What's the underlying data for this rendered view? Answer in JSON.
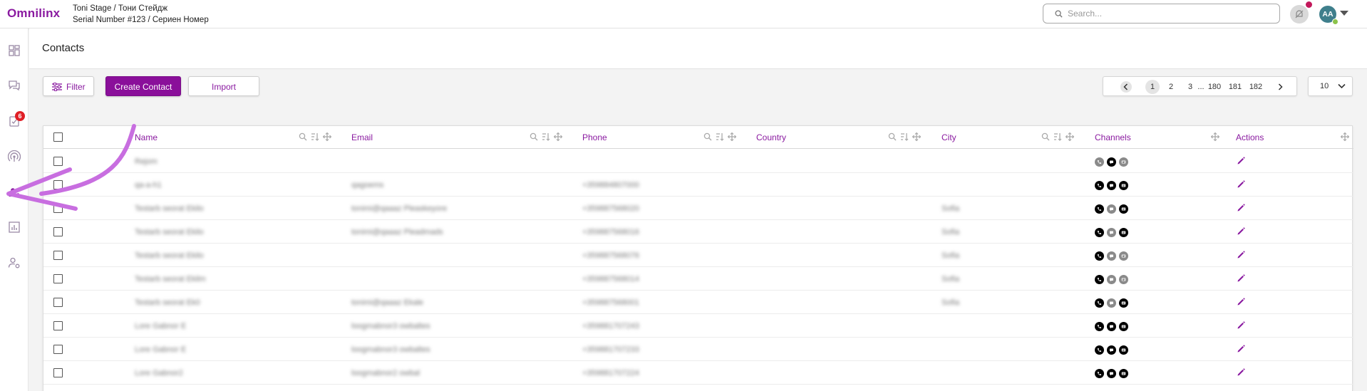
{
  "app": {
    "logo": "Omnilinx",
    "org_line1": "Toni Stage / Тони Стейдж",
    "org_line2": "Serial Number #123 / Сериен Номер"
  },
  "search": {
    "placeholder": "Search..."
  },
  "user": {
    "initials": "AA"
  },
  "sidebar": {
    "items": [
      {
        "icon": "dashboard-icon"
      },
      {
        "icon": "chat-icon"
      },
      {
        "icon": "tasks-icon",
        "badge": "6"
      },
      {
        "icon": "broadcast-icon"
      },
      {
        "icon": "contacts-icon",
        "active": true
      },
      {
        "icon": "reports-icon"
      },
      {
        "icon": "user-settings-icon"
      }
    ]
  },
  "page": {
    "title": "Contacts"
  },
  "toolbar": {
    "filter_label": "Filter",
    "create_label": "Create Contact",
    "import_label": "Import"
  },
  "pagination": {
    "pages": [
      "1",
      "2",
      "3",
      "...",
      "180",
      "181",
      "182"
    ],
    "current": "1",
    "page_size": "10"
  },
  "table": {
    "columns": {
      "name": "Name",
      "email": "Email",
      "phone": "Phone",
      "country": "Country",
      "city": "City",
      "channels": "Channels",
      "actions": "Actions"
    },
    "rows": [
      {
        "name": "Rejom",
        "email": "",
        "phone": "",
        "city": "",
        "channels": [
          "off",
          "on",
          "off"
        ]
      },
      {
        "name": "qa-a-h1",
        "email": "qagoems",
        "phone": "+359884807000",
        "city": "",
        "channels": [
          "on",
          "on",
          "on"
        ]
      },
      {
        "name": "Testarb seorat Ekilo",
        "email": "tonimi@qaaaz Pleaskeyore",
        "phone": "+359887568020",
        "city": "Sofia",
        "channels": [
          "on",
          "off",
          "on"
        ]
      },
      {
        "name": "Testarb seorat Ekilo",
        "email": "tonimi@qaaaz Pleadmads",
        "phone": "+359887568016",
        "city": "Sofia",
        "channels": [
          "on",
          "off",
          "on"
        ]
      },
      {
        "name": "Testarb seorat Ekilo",
        "email": "",
        "phone": "+359887568076",
        "city": "Sofia",
        "channels": [
          "on",
          "off",
          "off"
        ]
      },
      {
        "name": "Testarb seorat Ekilm",
        "email": "",
        "phone": "+359887568014",
        "city": "Sofia",
        "channels": [
          "on",
          "off",
          "off"
        ]
      },
      {
        "name": "Testarb seorat Ek0",
        "email": "tonimi@qaaaz Ekale",
        "phone": "+359887568001",
        "city": "Sofia",
        "channels": [
          "on",
          "off",
          "on"
        ]
      },
      {
        "name": "Lore Gabnor E",
        "email": "loogmabnor3 owbaltes",
        "phone": "+359881707243",
        "city": "",
        "channels": [
          "on",
          "on",
          "on"
        ]
      },
      {
        "name": "Lore Gabnor E",
        "email": "loogmabnor3 owbaltes",
        "phone": "+359881707233",
        "city": "",
        "channels": [
          "on",
          "on",
          "on"
        ]
      },
      {
        "name": "Lore Gabnor2",
        "email": "loogmabnor2 owbal",
        "phone": "+359881707224",
        "city": "",
        "channels": [
          "on",
          "on",
          "on"
        ]
      }
    ]
  },
  "colors": {
    "brand": "#8a1aa0",
    "primary_button": "#8a0f9a",
    "annotation_arrow": "#c86ee0",
    "badge": "#e01f26"
  }
}
